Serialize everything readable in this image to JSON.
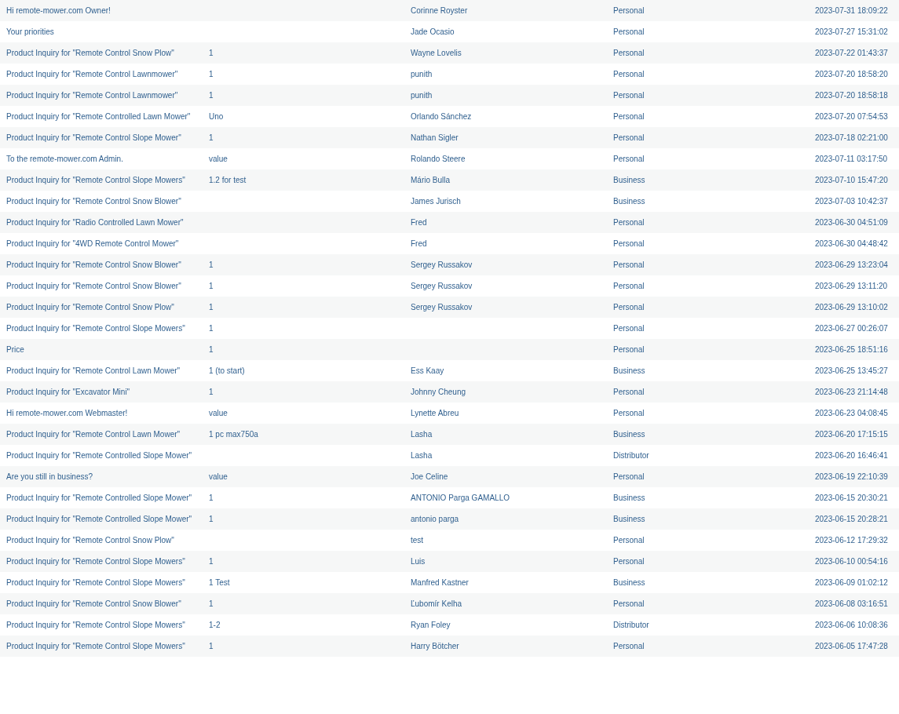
{
  "table": {
    "rows": [
      {
        "subject": "Hi remote-mower.com Owner!",
        "name": "Corinne Royster",
        "type": "Personal",
        "date": "2023-07-31 18:09:22"
      },
      {
        "subject": "Your priorities",
        "name": "Jade Ocasio",
        "type": "Personal",
        "date": "2023-07-27 15:31:02"
      },
      {
        "subject": "Product Inquiry for \"Remote Control Snow Plow\"",
        "quantity": "1",
        "name": "Wayne Lovelis",
        "type": "Personal",
        "date": "2023-07-22 01:43:37"
      },
      {
        "subject": "Product Inquiry for \"Remote Control Lawnmower\"",
        "quantity": "1",
        "name": "punith",
        "type": "Personal",
        "date": "2023-07-20 18:58:20"
      },
      {
        "subject": "Product Inquiry for \"Remote Control Lawnmower\"",
        "quantity": "1",
        "name": "punith",
        "type": "Personal",
        "date": "2023-07-20 18:58:18"
      },
      {
        "subject": "Product Inquiry for \"Remote Controlled Lawn Mower\"",
        "quantity": "Uno",
        "name": "Orlando Sánchez",
        "type": "Personal",
        "date": "2023-07-20 07:54:53"
      },
      {
        "subject": "Product Inquiry for \"Remote Control Slope Mower\"",
        "quantity": "1",
        "name": "Nathan Sigler",
        "type": "Personal",
        "date": "2023-07-18 02:21:00"
      },
      {
        "subject": "To the remote-mower.com Admin.",
        "quantity": "value",
        "name": "Rolando Steere",
        "type": "Personal",
        "date": "2023-07-11 03:17:50"
      },
      {
        "subject": "Product Inquiry for \"Remote Control Slope Mowers\"",
        "quantity": "1.2 for test",
        "name": "Mário Bulla",
        "type": "Business",
        "date": "2023-07-10 15:47:20"
      },
      {
        "subject": "Product Inquiry for \"Remote Control Snow Blower\"",
        "name": "James Jurisch",
        "type": "Business",
        "date": "2023-07-03 10:42:37"
      },
      {
        "subject": "Product Inquiry for \"Radio Controlled Lawn Mower\"",
        "name": "Fred",
        "type": "Personal",
        "date": "2023-06-30 04:51:09"
      },
      {
        "subject": "Product Inquiry for \"4WD Remote Control Mower\"",
        "name": "Fred",
        "type": "Personal",
        "date": "2023-06-30 04:48:42"
      },
      {
        "subject": "Product Inquiry for \"Remote Control Snow Blower\"",
        "quantity": "1",
        "name": "Sergey Russakov",
        "type": "Personal",
        "date": "2023-06-29 13:23:04"
      },
      {
        "subject": "Product Inquiry for \"Remote Control Snow Blower\"",
        "quantity": "1",
        "name": "Sergey Russakov",
        "type": "Personal",
        "date": "2023-06-29 13:11:20"
      },
      {
        "subject": "Product Inquiry for \"Remote Control Snow Plow\"",
        "quantity": "1",
        "name": "Sergey Russakov",
        "type": "Personal",
        "date": "2023-06-29 13:10:02"
      },
      {
        "subject": "Product Inquiry for \"Remote Control Slope Mowers\"",
        "quantity": "1",
        "type": "Personal",
        "date": "2023-06-27 00:26:07"
      },
      {
        "subject": "Price",
        "quantity": "1",
        "type": "Personal",
        "date": "2023-06-25 18:51:16"
      },
      {
        "subject": "Product Inquiry for \"Remote Control Lawn Mower\"",
        "quantity": "1 (to start)",
        "name": "Ess Kaay",
        "type": "Business",
        "date": "2023-06-25 13:45:27"
      },
      {
        "subject": "Product Inquiry for \"Excavator Mini\"",
        "quantity": "1",
        "name": "Johnny Cheung",
        "type": "Personal",
        "date": "2023-06-23 21:14:48"
      },
      {
        "subject": "Hi remote-mower.com Webmaster!",
        "quantity": "value",
        "name": "Lynette Abreu",
        "type": "Personal",
        "date": "2023-06-23 04:08:45"
      },
      {
        "subject": "Product Inquiry for \"Remote Control Lawn Mower\"",
        "quantity": "1 pc max750a",
        "name": "Lasha",
        "type": "Business",
        "date": "2023-06-20 17:15:15"
      },
      {
        "subject": "Product Inquiry for \"Remote Controlled Slope Mower\"",
        "name": "Lasha",
        "type": "Distributor",
        "date": "2023-06-20 16:46:41"
      },
      {
        "subject": "Are you still in business?",
        "quantity": "value",
        "name": "Joe Celine",
        "type": "Personal",
        "date": "2023-06-19 22:10:39"
      },
      {
        "subject": "Product Inquiry for \"Remote Controlled Slope Mower\"",
        "quantity": "1",
        "name": "ANTONIO Parga GAMALLO",
        "type": "Business",
        "date": "2023-06-15 20:30:21"
      },
      {
        "subject": "Product Inquiry for \"Remote Controlled Slope Mower\"",
        "quantity": "1",
        "name": "antonio parga",
        "type": "Business",
        "date": "2023-06-15 20:28:21"
      },
      {
        "subject": "Product Inquiry for \"Remote Control Snow Plow\"",
        "name": "test",
        "type": "Personal",
        "date": "2023-06-12 17:29:32"
      },
      {
        "subject": "Product Inquiry for \"Remote Control Slope Mowers\"",
        "quantity": "1",
        "name": "Luis",
        "type": "Personal",
        "date": "2023-06-10 00:54:16"
      },
      {
        "subject": "Product Inquiry for \"Remote Control Slope Mowers\"",
        "quantity": "1 Test",
        "name": "Manfred Kastner",
        "type": "Business",
        "date": "2023-06-09 01:02:12"
      },
      {
        "subject": "Product Inquiry for \"Remote Control Snow Blower\"",
        "quantity": "1",
        "name": "Ľubomír Kelha",
        "type": "Personal",
        "date": "2023-06-08 03:16:51"
      },
      {
        "subject": "Product Inquiry for \"Remote Control Slope Mowers\"",
        "quantity": "1-2",
        "name": "Ryan Foley",
        "type": "Distributor",
        "date": "2023-06-06 10:08:36"
      },
      {
        "subject": "Product Inquiry for \"Remote Control Slope Mowers\"",
        "quantity": "1",
        "name": "Harry Bötcher",
        "type": "Personal",
        "date": "2023-06-05 17:47:28"
      }
    ]
  }
}
